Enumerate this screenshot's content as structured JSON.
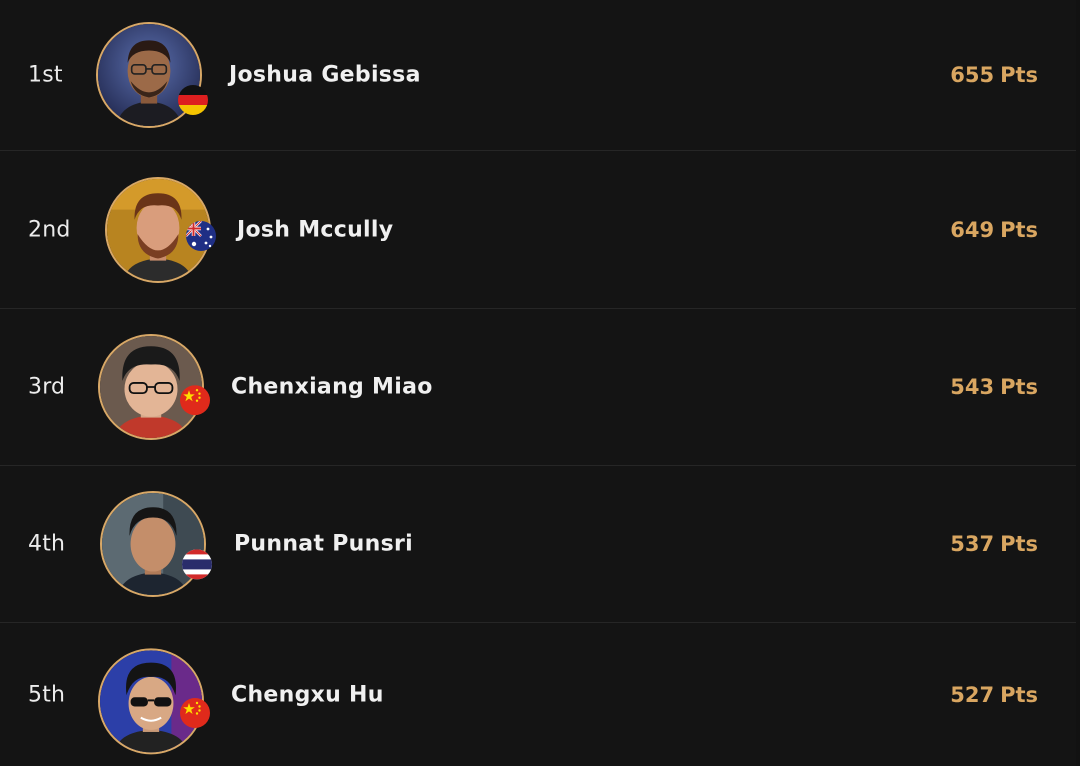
{
  "leaderboard": {
    "entries": [
      {
        "rank": "1st",
        "name": "Joshua Gebissa",
        "points": "655",
        "unit": "Pts",
        "country_icon": "germany-flag-icon",
        "avatar_icon": "player-avatar-icon"
      },
      {
        "rank": "2nd",
        "name": "Josh Mccully",
        "points": "649",
        "unit": "Pts",
        "country_icon": "australia-flag-icon",
        "avatar_icon": "player-avatar-icon"
      },
      {
        "rank": "3rd",
        "name": "Chenxiang Miao",
        "points": "543",
        "unit": "Pts",
        "country_icon": "china-flag-icon",
        "avatar_icon": "player-avatar-icon"
      },
      {
        "rank": "4th",
        "name": "Punnat Punsri",
        "points": "537",
        "unit": "Pts",
        "country_icon": "thailand-flag-icon",
        "avatar_icon": "player-avatar-icon"
      },
      {
        "rank": "5th",
        "name": "Chengxu Hu",
        "points": "527",
        "unit": "Pts",
        "country_icon": "china-flag-icon",
        "avatar_icon": "player-avatar-icon"
      }
    ]
  },
  "colors": {
    "background": "#121212",
    "row_divider": "#262626",
    "accent_gold": "#d9a661",
    "avatar_ring": "#d8a867",
    "text": "#f0f0f0"
  }
}
